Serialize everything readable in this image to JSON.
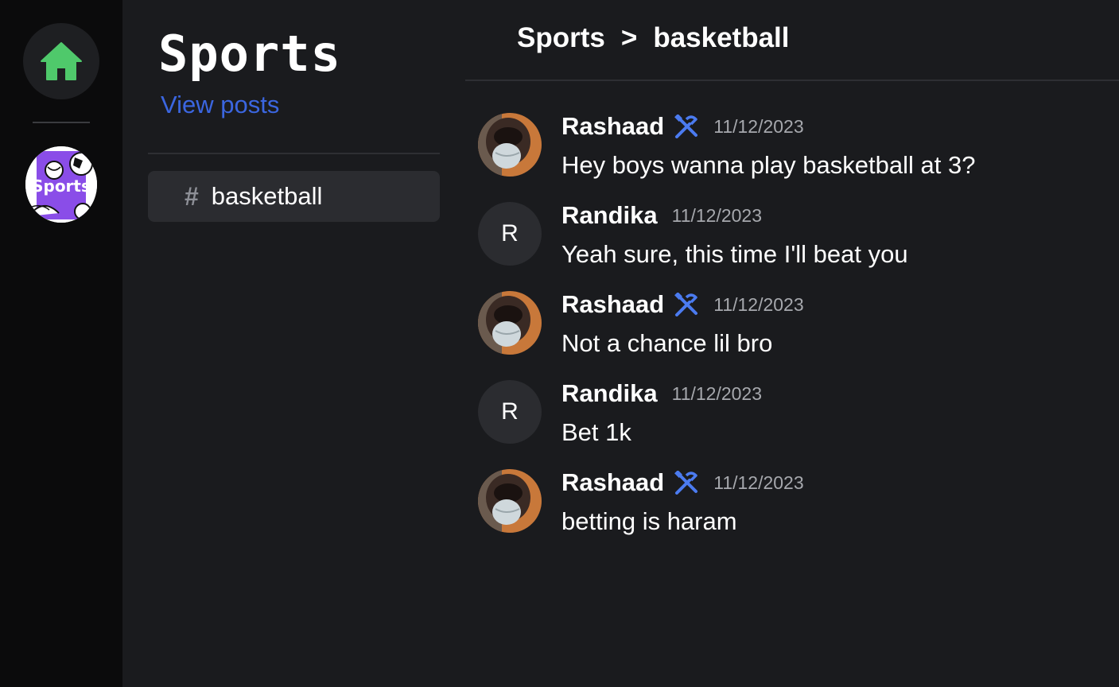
{
  "rail": {
    "home_icon": "home-icon",
    "server_logo_text": "Sports",
    "accent_color": "#4fc96b"
  },
  "channel_list": {
    "server_title": "Sports",
    "view_posts": "View posts",
    "channels": [
      {
        "hash": "#",
        "name": "basketball"
      }
    ]
  },
  "main": {
    "breadcrumb": {
      "server": "Sports",
      "separator": ">",
      "channel": "basketball"
    },
    "messages": [
      {
        "username": "Rashaad",
        "avatar": "photo",
        "role_icon": "tools-icon",
        "date": "11/12/2023",
        "text": "Hey boys wanna play basketball at 3?"
      },
      {
        "username": "Randika",
        "avatar": "R",
        "role_icon": null,
        "date": "11/12/2023",
        "text": "Yeah sure, this time I'll beat you"
      },
      {
        "username": "Rashaad",
        "avatar": "photo",
        "role_icon": "tools-icon",
        "date": "11/12/2023",
        "text": "Not a chance lil bro"
      },
      {
        "username": "Randika",
        "avatar": "R",
        "role_icon": null,
        "date": "11/12/2023",
        "text": "Bet 1k"
      },
      {
        "username": "Rashaad",
        "avatar": "photo",
        "role_icon": "tools-icon",
        "date": "11/12/2023",
        "text": "betting is haram"
      }
    ]
  },
  "colors": {
    "link": "#3b66e0",
    "role_icon": "#4b7bf0",
    "background": "#1a1b1e",
    "rail": "#0b0b0c"
  }
}
